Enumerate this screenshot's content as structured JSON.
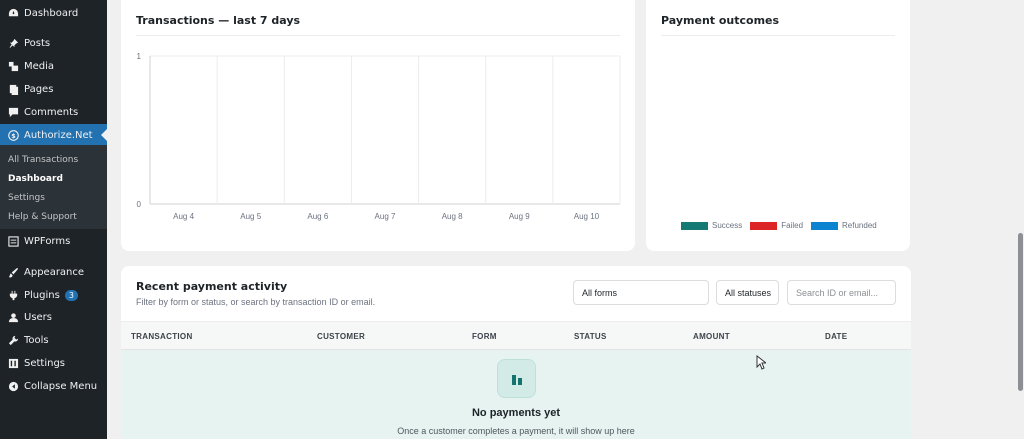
{
  "sidebar": {
    "items": [
      {
        "label": "Dashboard",
        "icon": "dashboard-icon"
      },
      {
        "label": "Posts",
        "icon": "pin-icon"
      },
      {
        "label": "Media",
        "icon": "media-icon"
      },
      {
        "label": "Pages",
        "icon": "pages-icon"
      },
      {
        "label": "Comments",
        "icon": "comments-icon"
      },
      {
        "label": "Authorize.Net",
        "icon": "dollar-icon"
      },
      {
        "label": "WPForms",
        "icon": "wpforms-icon"
      },
      {
        "label": "Appearance",
        "icon": "brush-icon"
      },
      {
        "label": "Plugins",
        "icon": "plugin-icon",
        "badge": "3"
      },
      {
        "label": "Users",
        "icon": "users-icon"
      },
      {
        "label": "Tools",
        "icon": "wrench-icon"
      },
      {
        "label": "Settings",
        "icon": "settings-icon"
      },
      {
        "label": "Collapse Menu",
        "icon": "collapse-icon"
      }
    ],
    "submenu": [
      "All Transactions",
      "Dashboard",
      "Settings",
      "Help & Support"
    ]
  },
  "transactions_card": {
    "title": "Transactions — last 7 days"
  },
  "outcomes_card": {
    "title": "Payment outcomes",
    "legend": [
      {
        "label": "Success",
        "color": "#167a74"
      },
      {
        "label": "Failed",
        "color": "#dc2626"
      },
      {
        "label": "Refunded",
        "color": "#0a84d0"
      }
    ]
  },
  "chart_data": {
    "type": "line",
    "title": "Transactions — last 7 days",
    "categories": [
      "Aug 4",
      "Aug 5",
      "Aug 6",
      "Aug 7",
      "Aug 8",
      "Aug 9",
      "Aug 10"
    ],
    "series": [
      {
        "values": [
          0,
          0,
          0,
          0,
          0,
          0,
          0
        ]
      }
    ],
    "ylim": [
      0,
      1
    ],
    "yticks": [
      "0",
      "1"
    ],
    "grid": true
  },
  "recent": {
    "title": "Recent payment activity",
    "subtitle": "Filter by form or status, or search by transaction ID or email.",
    "forms_select": "All forms",
    "status_select": "All statuses",
    "search_placeholder": "Search ID or email...",
    "columns": [
      "TRANSACTION",
      "CUSTOMER",
      "FORM",
      "STATUS",
      "AMOUNT",
      "DATE"
    ],
    "empty_title": "No payments yet",
    "empty_text": "Once a customer completes a payment, it will show up here"
  }
}
